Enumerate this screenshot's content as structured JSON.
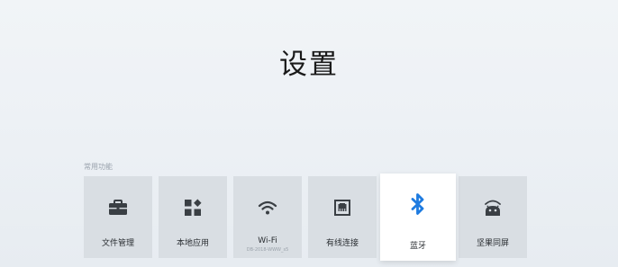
{
  "header": {
    "title": "设置"
  },
  "section": {
    "label": "常用功能"
  },
  "tiles": [
    {
      "label": "文件管理",
      "icon": "briefcase-icon"
    },
    {
      "label": "本地应用",
      "icon": "apps-grid-icon"
    },
    {
      "label": "Wi-Fi",
      "sublabel": "DB-2018-WWW_s5",
      "icon": "wifi-icon"
    },
    {
      "label": "有线连接",
      "icon": "ethernet-icon"
    },
    {
      "label": "蓝牙",
      "icon": "bluetooth-icon",
      "selected": true
    },
    {
      "label": "坚果同屏",
      "icon": "android-cast-icon"
    }
  ],
  "colors": {
    "accent": "#1e7be0",
    "icon": "#3a3f44",
    "tile": "#d9dee3",
    "selected_tile": "#ffffff"
  }
}
